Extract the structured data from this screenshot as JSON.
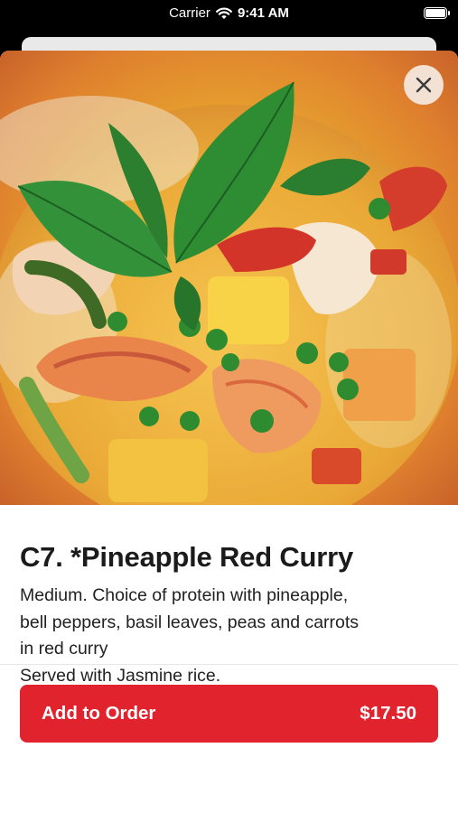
{
  "status_bar": {
    "carrier": "Carrier",
    "time": "9:41 AM"
  },
  "item": {
    "title": "C7. *Pineapple Red Curry",
    "description": "Medium. Choice of protein with pineapple,\nbell peppers, basil leaves, peas and carrots\nin red curry\nServed with Jasmine rice."
  },
  "order": {
    "button_label": "Add to Order",
    "price": "$17.50"
  },
  "colors": {
    "accent": "#e1232e",
    "close_bg": "#f3e1d3"
  },
  "icons": {
    "close": "close-icon",
    "wifi": "wifi-icon",
    "battery": "battery-icon"
  }
}
